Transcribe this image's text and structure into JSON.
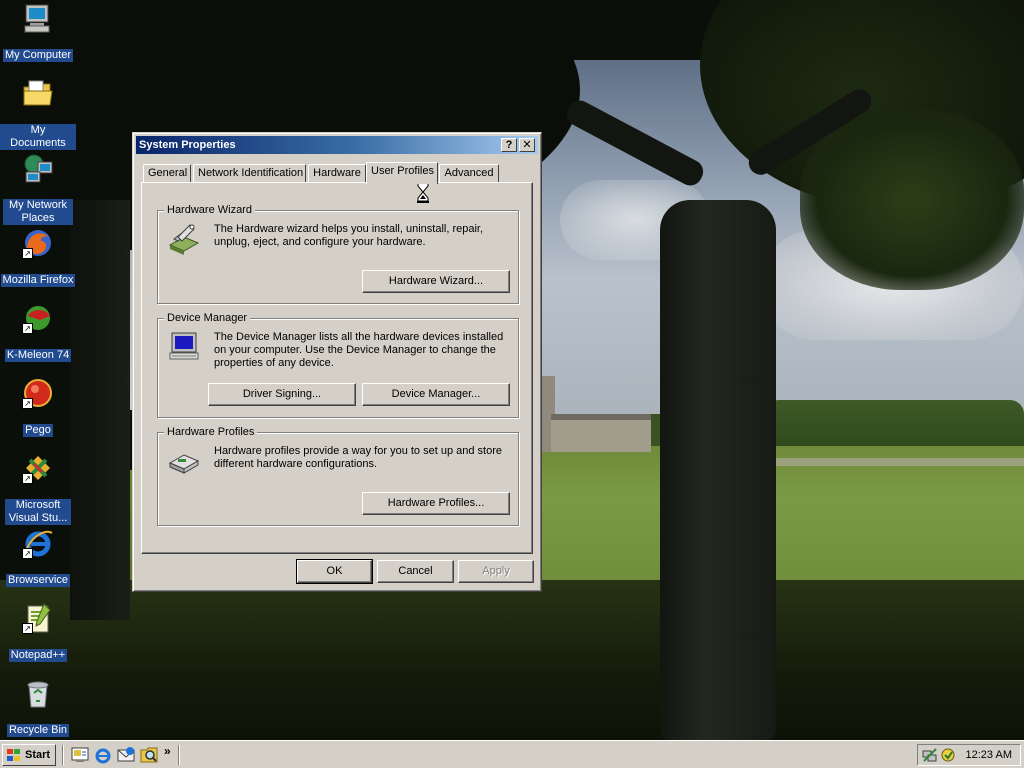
{
  "desktop": {
    "icons": [
      {
        "label": "My Computer",
        "icon": "computer-icon"
      },
      {
        "label": "My Documents",
        "icon": "folder-icon"
      },
      {
        "label": "My Network Places",
        "icon": "network-icon"
      },
      {
        "label": "Mozilla Firefox",
        "icon": "firefox-icon"
      },
      {
        "label": "K-Meleon 74",
        "icon": "k-meleon-icon"
      },
      {
        "label": "Pego",
        "icon": "pego-icon"
      },
      {
        "label": "Microsoft Visual Stu...",
        "icon": "visual-studio-icon"
      },
      {
        "label": "Browservice",
        "icon": "internet-explorer-icon"
      },
      {
        "label": "Notepad++",
        "icon": "notepad-icon"
      },
      {
        "label": "Recycle Bin",
        "icon": "recycle-bin-icon"
      }
    ]
  },
  "dialog": {
    "title": "System Properties",
    "help_button": "?",
    "close_button": "✕",
    "tabs": [
      "General",
      "Network Identification",
      "Hardware",
      "User Profiles",
      "Advanced"
    ],
    "active_tab": "User Profiles",
    "groups": {
      "wizard": {
        "title": "Hardware Wizard",
        "description": "The Hardware wizard helps you install, uninstall, repair, unplug, eject, and configure your hardware.",
        "button": "Hardware Wizard..."
      },
      "device_manager": {
        "title": "Device Manager",
        "description": "The Device Manager lists all the hardware devices installed on your computer. Use the Device Manager to change the properties of any device.",
        "button_signing": "Driver Signing...",
        "button_manager": "Device Manager..."
      },
      "profiles": {
        "title": "Hardware Profiles",
        "description": "Hardware profiles provide a way for you to set up and store different hardware configurations.",
        "button": "Hardware Profiles..."
      }
    },
    "buttons": {
      "ok": "OK",
      "cancel": "Cancel",
      "apply": "Apply"
    }
  },
  "taskbar": {
    "start_label": "Start",
    "more_quicklaunch": "»",
    "clock": "12:23 AM"
  },
  "colors": {
    "titlebar_start": "#0a246a",
    "titlebar_end": "#a6caf0",
    "face": "#d4d0c8",
    "icon_label_bg": "#214a8f"
  }
}
